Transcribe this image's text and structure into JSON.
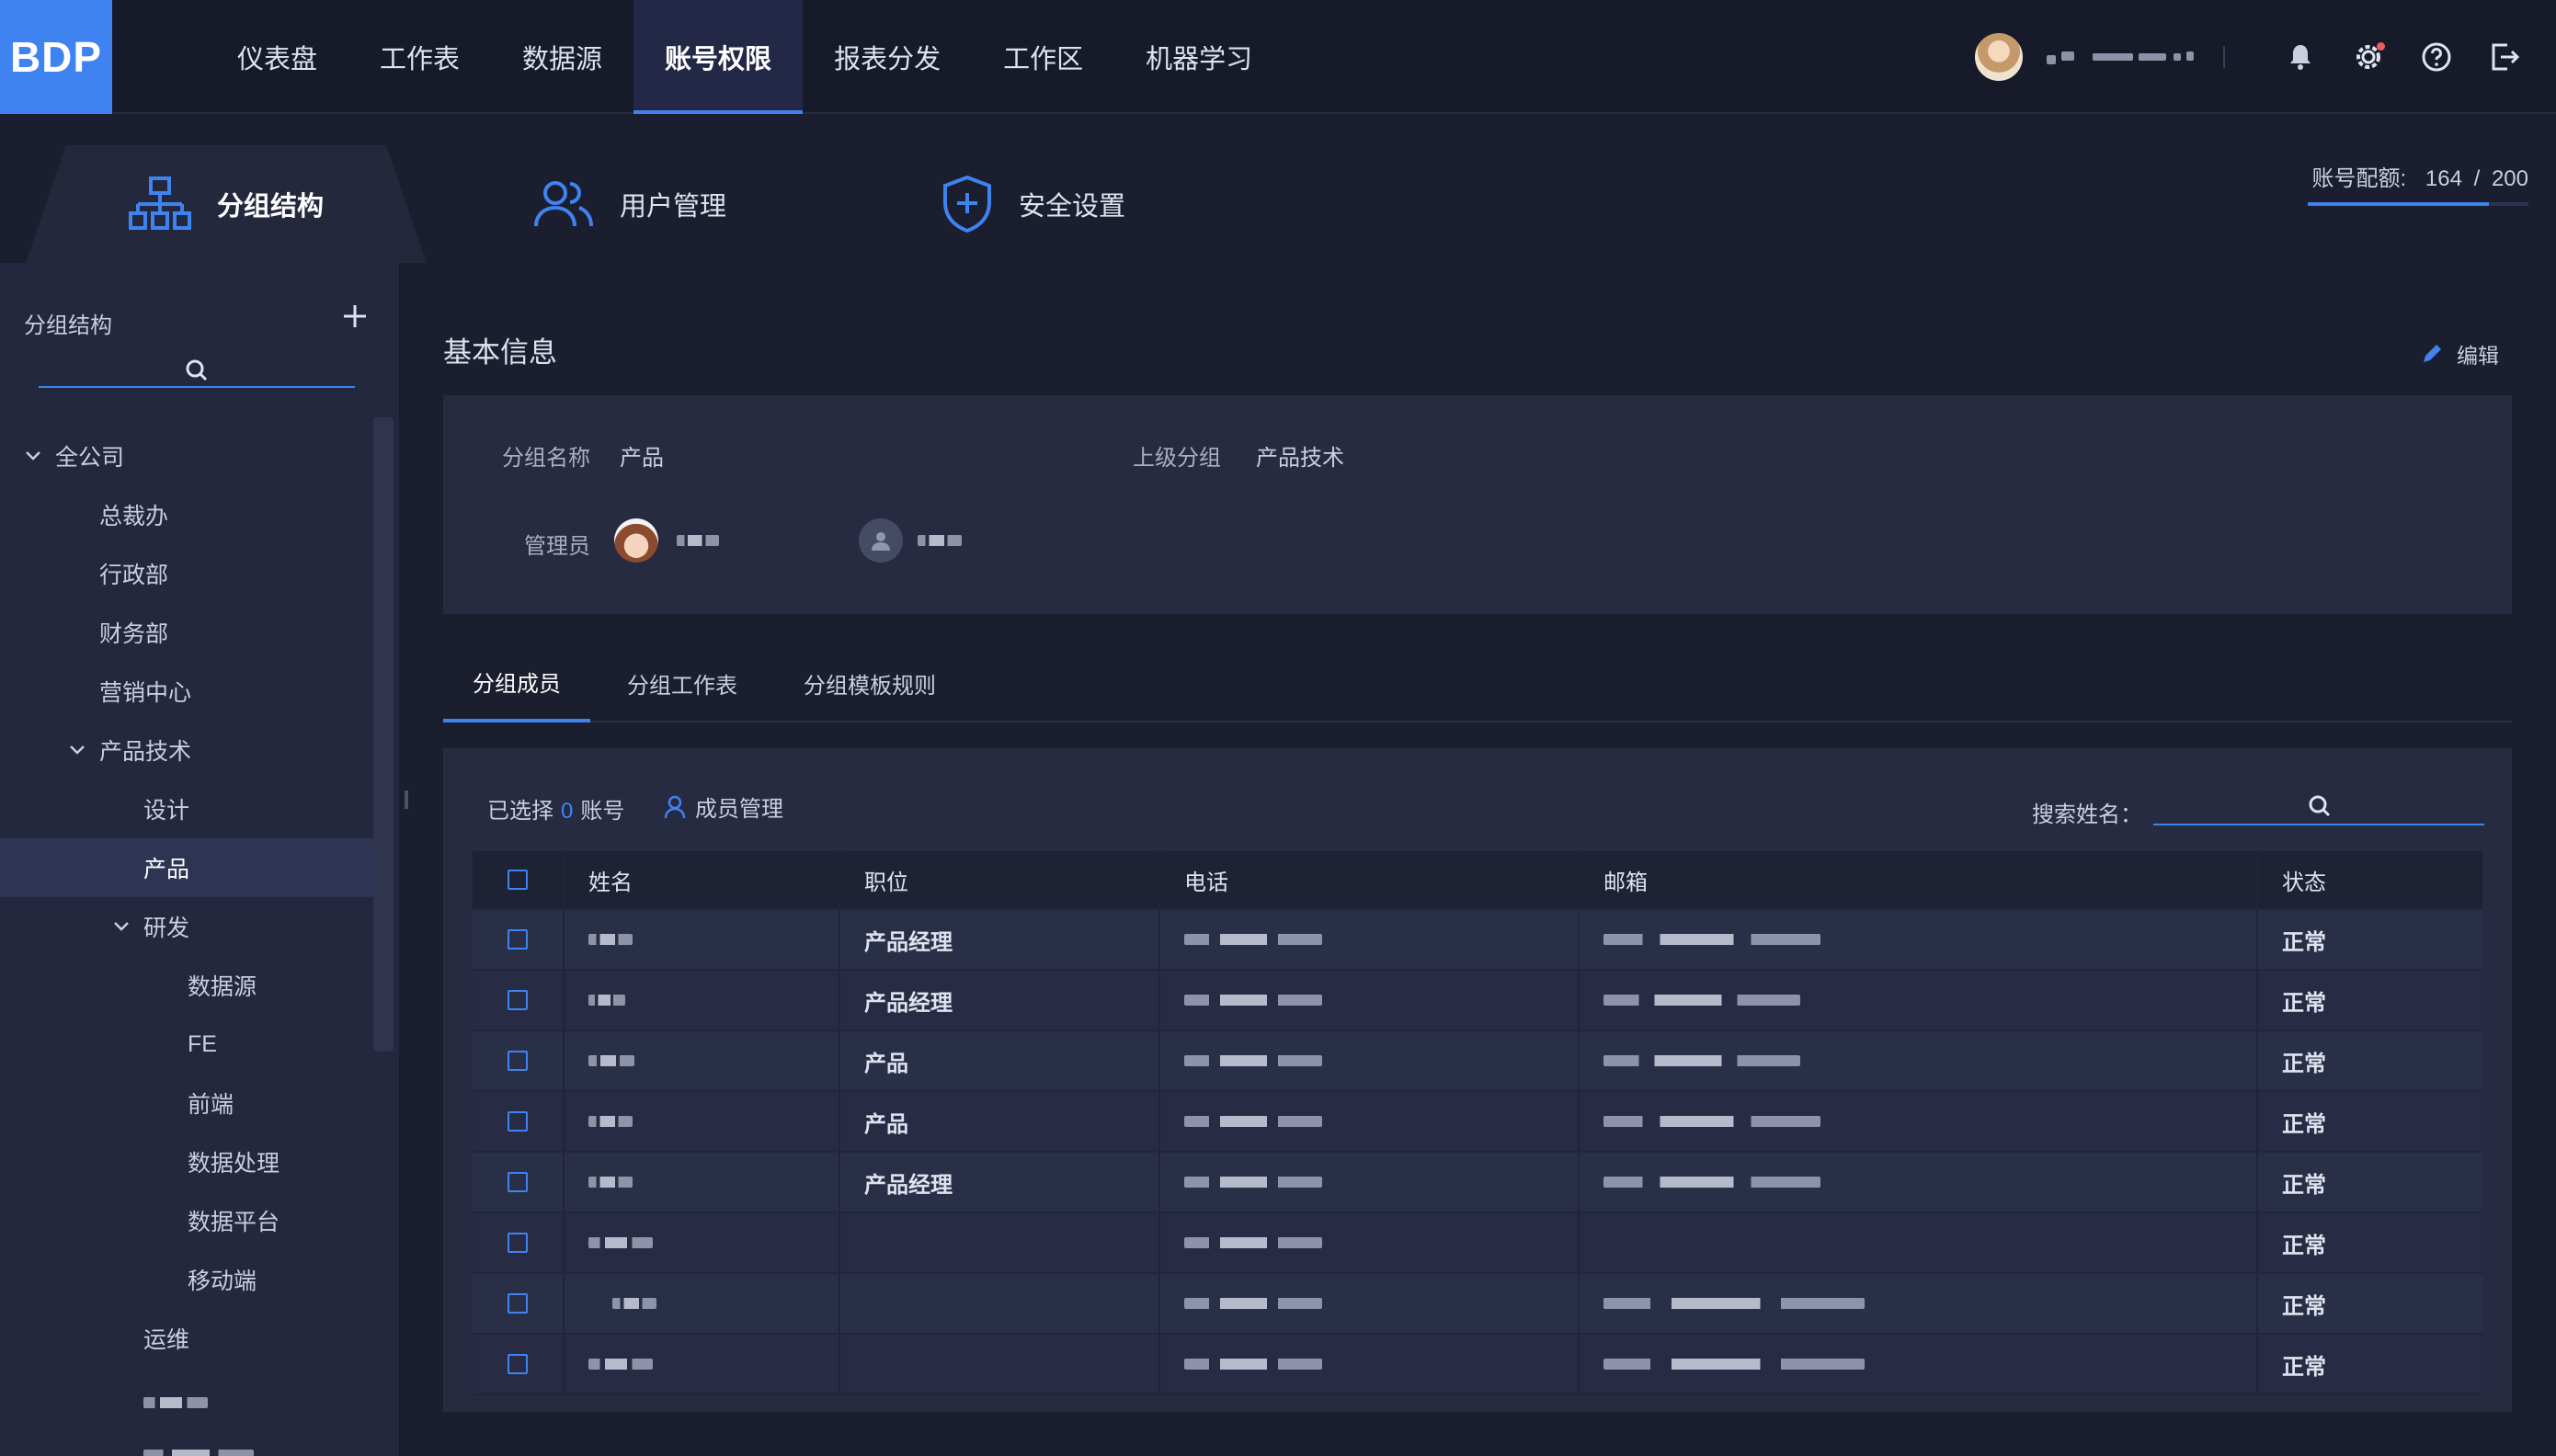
{
  "app": {
    "logo": "BDP"
  },
  "nav": {
    "items": [
      {
        "label": "仪表盘",
        "active": false
      },
      {
        "label": "工作表",
        "active": false
      },
      {
        "label": "数据源",
        "active": false
      },
      {
        "label": "账号权限",
        "active": true
      },
      {
        "label": "报表分发",
        "active": false
      },
      {
        "label": "工作区",
        "active": false
      },
      {
        "label": "机器学习",
        "active": false
      }
    ]
  },
  "section_tabs": [
    {
      "label": "分组结构",
      "icon": "org-structure-icon",
      "active": true
    },
    {
      "label": "用户管理",
      "icon": "users-icon",
      "active": false
    },
    {
      "label": "安全设置",
      "icon": "shield-icon",
      "active": false
    }
  ],
  "quota": {
    "label": "账号配额:",
    "used": "164",
    "sep": "/",
    "total": "200",
    "fraction": 0.82
  },
  "sidebar": {
    "title": "分组结构",
    "tree": [
      {
        "label": "全公司",
        "level": 0,
        "expanded": true
      },
      {
        "label": "总裁办",
        "level": 1
      },
      {
        "label": "行政部",
        "level": 1
      },
      {
        "label": "财务部",
        "level": 1
      },
      {
        "label": "营销中心",
        "level": 1
      },
      {
        "label": "产品技术",
        "level": 1,
        "expanded": true
      },
      {
        "label": "设计",
        "level": 2
      },
      {
        "label": "产品",
        "level": 2,
        "selected": true
      },
      {
        "label": "研发",
        "level": 2,
        "expanded": true
      },
      {
        "label": "数据源",
        "level": 3
      },
      {
        "label": "FE",
        "level": 3
      },
      {
        "label": "前端",
        "level": 3
      },
      {
        "label": "数据处理",
        "level": 3
      },
      {
        "label": "数据平台",
        "level": 3
      },
      {
        "label": "移动端",
        "level": 3
      },
      {
        "label": "运维",
        "level": 2
      }
    ]
  },
  "basic_info": {
    "title": "基本信息",
    "edit_label": "编辑",
    "group_name_label": "分组名称",
    "group_name": "产品",
    "parent_label": "上级分组",
    "parent": "产品技术",
    "admin_label": "管理员"
  },
  "tabs": [
    {
      "label": "分组成员",
      "active": true
    },
    {
      "label": "分组工作表",
      "active": false
    },
    {
      "label": "分组模板规则",
      "active": false
    }
  ],
  "members": {
    "selected_prefix": "已选择",
    "selected_count": "0",
    "selected_suffix": "账号",
    "manage_label": "成员管理",
    "search_label": "搜索姓名：",
    "columns": [
      "姓名",
      "职位",
      "电话",
      "邮箱",
      "状态"
    ],
    "rows": [
      {
        "position": "产品经理",
        "status": "正常"
      },
      {
        "position": "产品经理",
        "status": "正常"
      },
      {
        "position": "产品",
        "status": "正常"
      },
      {
        "position": "产品",
        "status": "正常"
      },
      {
        "position": "产品经理",
        "status": "正常"
      },
      {
        "position": "",
        "status": "正常"
      },
      {
        "position": "",
        "status": "正常"
      },
      {
        "position": "",
        "status": "正常"
      }
    ]
  },
  "colors": {
    "accent": "#3f83f0",
    "background": "#1b1e2e",
    "panel": "#262b42",
    "sidebar": "#23283e"
  }
}
